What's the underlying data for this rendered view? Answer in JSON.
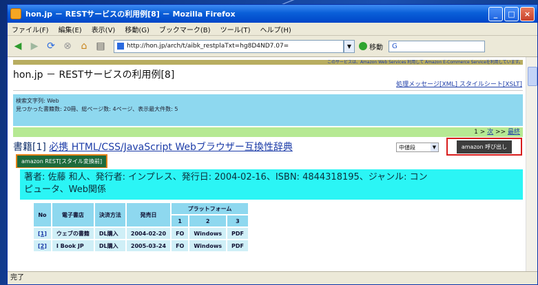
{
  "window": {
    "title": "hon.jp － RESTサービスの利用例[8] － Mozilla Firefox"
  },
  "menu": [
    "ファイル(F)",
    "編集(E)",
    "表示(V)",
    "移動(G)",
    "ブックマーク(B)",
    "ツール(T)",
    "ヘルプ(H)"
  ],
  "nav": {
    "url": "http://hon.jp/arch/t/aibk_restplaTxt=hg8D4ND7.07=",
    "go_label": "移動",
    "search_value": "G"
  },
  "page": {
    "top_bar_links": "このサービスは、Amazon Web Services 利用して Amazon E-Commerce Serviceを利用しています。",
    "title": "hon.jp － RESTサービスの利用例[8]",
    "xml_links": "処理メッセージ[XML] スタイルシート[XSLT]",
    "search_info": {
      "line1": "検索文字列: Web",
      "line2": "見つかった書籍数: 20冊、総ページ数: 4ページ、表示最大件数: 5"
    },
    "pager": {
      "pages": "1 > ",
      "next": "次",
      "sep": " >> ",
      "last": "最終"
    },
    "book": {
      "label": "書籍[1]",
      "title": "必携 HTML/CSS/JavaScript Webブラウザー互換性辞典",
      "select_value": "中値段",
      "amazon_button": "amazon 呼び出し",
      "rest_button": "amazon REST[スタイル変換前]",
      "author_line1": "著者: 佐藤 和人、発行者: インプレス、発行日: 2004-02-16、ISBN: 4844318195、ジャンル: コン",
      "author_line2": "ピュータ、Web関係"
    },
    "table": {
      "headers": [
        "No",
        "電子書店",
        "決済方法",
        "発売日",
        "プラットフォーム"
      ],
      "platform_sub": [
        "1",
        "2",
        "3"
      ],
      "rows": [
        {
          "no": "[1]",
          "store": "ウェブの書籍",
          "pay": "DL購入",
          "date": "2004-02-20",
          "p1": "FO",
          "p2": "Windows",
          "p3": "PDF"
        },
        {
          "no": "[2]",
          "store": "I Book JP",
          "pay": "DL購入",
          "date": "2005-03-24",
          "p1": "FO",
          "p2": "Windows",
          "p3": "PDF"
        }
      ]
    }
  },
  "status": "完了"
}
